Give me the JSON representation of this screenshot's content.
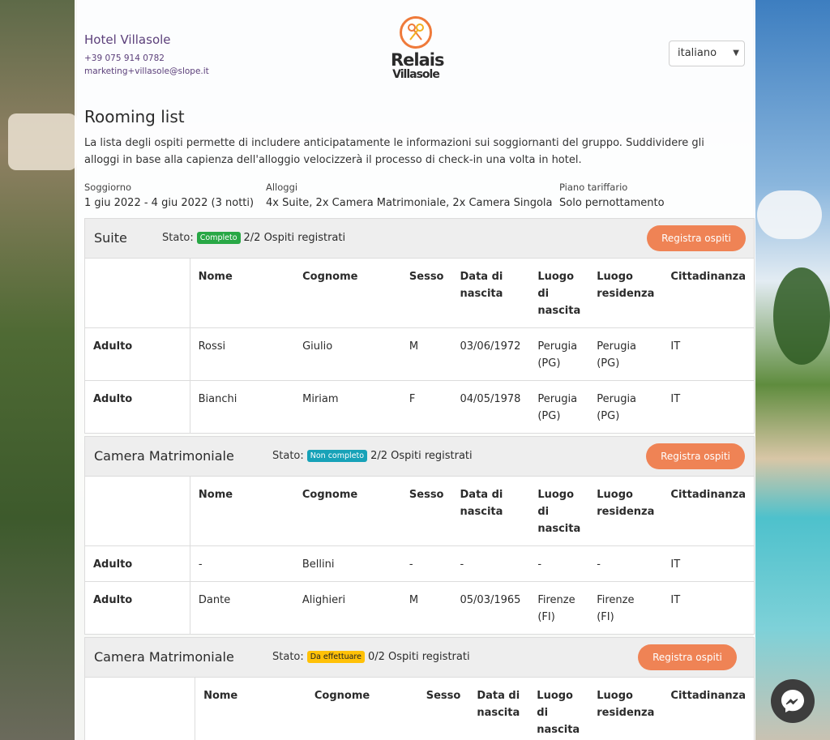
{
  "hotel": {
    "name": "Hotel Villasole",
    "phone": "+39 075 914 0782",
    "email": "marketing+villasole@slope.it",
    "logo_line1": "Relais",
    "logo_line2": "Villasole"
  },
  "language_select": {
    "value": "italiano"
  },
  "title": "Rooming list",
  "intro": "La lista degli ospiti permette di includere anticipatamente le informazioni sui soggiornanti del gruppo. Suddividere gli alloggi in base alla capienza dell'alloggio velocizzerà il processo di check-in una volta in hotel.",
  "meta": [
    {
      "label": "Soggiorno",
      "value": "1 giu 2022 - 4 giu 2022 (3 notti)"
    },
    {
      "label": "Alloggi",
      "value": "4x Suite, 2x Camera Matrimoniale, 2x Camera Singola"
    },
    {
      "label": "Piano tariffario",
      "value": "Solo pernottamento"
    }
  ],
  "columns": [
    "Nome",
    "Cognome",
    "Sesso",
    "Data di nascita",
    "Luogo di nascita",
    "Luogo residenza",
    "Cittadinanza"
  ],
  "stato_label": "Stato:",
  "register_label": "Registra ospiti",
  "rooms": [
    {
      "name": "Suite",
      "status": "Completo",
      "status_color": "#28a745",
      "count": "2/2 Ospiti registrati",
      "rows": [
        {
          "type": "Adulto",
          "nome": "Rossi",
          "cognome": "Giulio",
          "sesso": "M",
          "nascita": "03/06/1972",
          "luogo_nascita": "Perugia (PG)",
          "residenza": "Perugia (PG)",
          "cittadinanza": "IT"
        },
        {
          "type": "Adulto",
          "nome": "Bianchi",
          "cognome": "Miriam",
          "sesso": "F",
          "nascita": "04/05/1978",
          "luogo_nascita": "Perugia (PG)",
          "residenza": "Perugia (PG)",
          "cittadinanza": "IT"
        }
      ]
    },
    {
      "name": "Camera Matrimoniale",
      "status": "Non completo",
      "status_color": "#17a2b8",
      "count": "2/2 Ospiti registrati",
      "rows": [
        {
          "type": "Adulto",
          "nome": "-",
          "cognome": "Bellini",
          "sesso": "-",
          "nascita": "-",
          "luogo_nascita": "-",
          "residenza": "-",
          "cittadinanza": "IT"
        },
        {
          "type": "Adulto",
          "nome": "Dante",
          "cognome": "Alighieri",
          "sesso": "M",
          "nascita": "05/03/1965",
          "luogo_nascita": "Firenze (FI)",
          "residenza": "Firenze (FI)",
          "cittadinanza": "IT"
        }
      ]
    },
    {
      "name": "Camera Matrimoniale",
      "status": "Da effettuare",
      "status_color": "#ffc107",
      "count": "0/2 Ospiti registrati",
      "rows": []
    }
  ]
}
